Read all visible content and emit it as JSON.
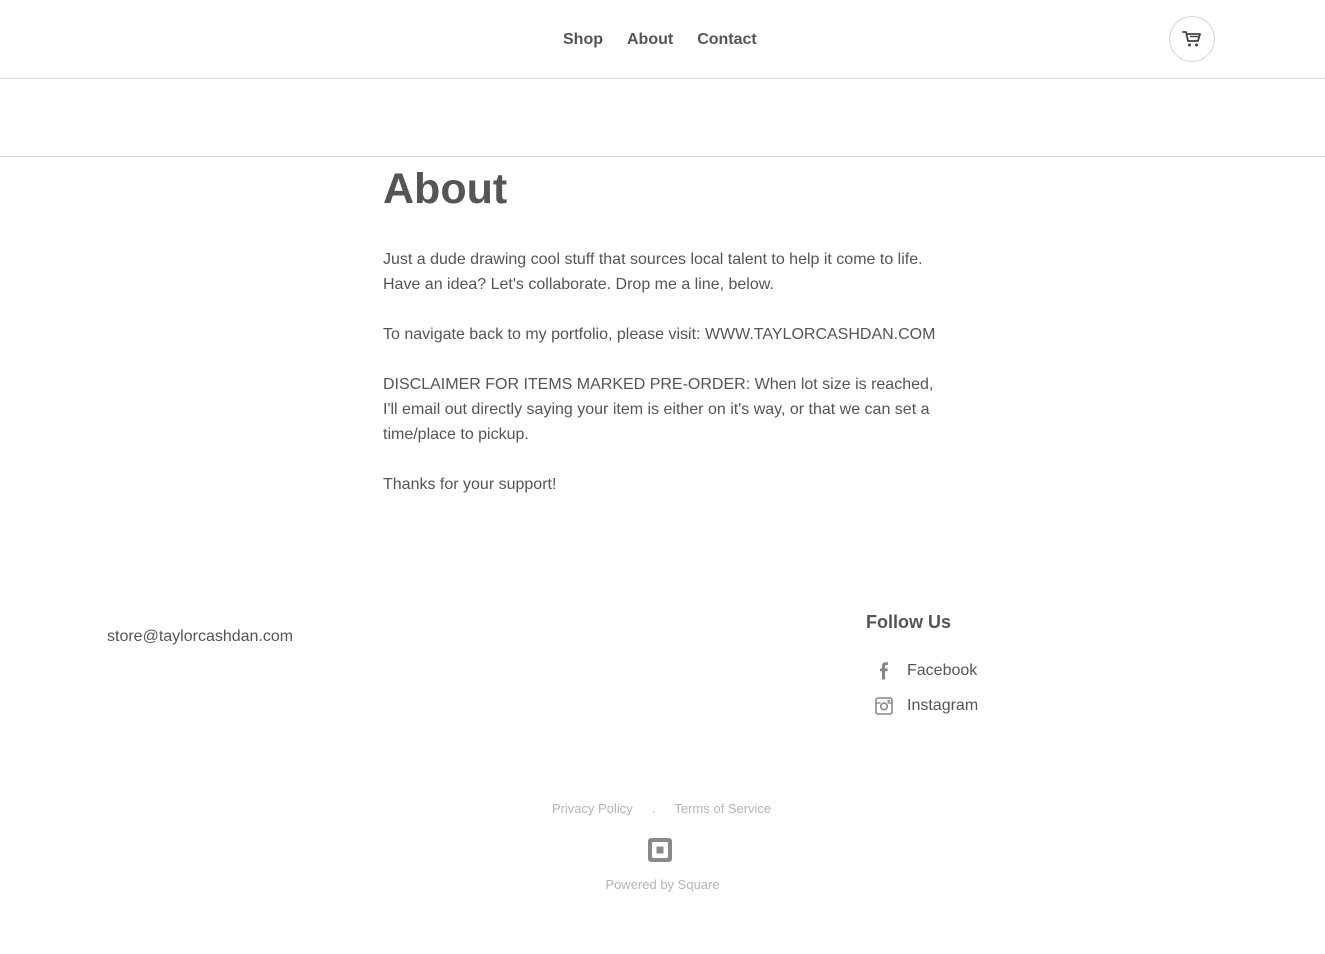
{
  "nav": {
    "items": [
      {
        "label": "Shop"
      },
      {
        "label": "About"
      },
      {
        "label": "Contact"
      }
    ],
    "cart_icon": "cart-icon"
  },
  "page": {
    "title": "About",
    "paragraphs": [
      "Just a dude drawing cool stuff that sources local talent to help it come to life. Have an idea? Let's collaborate. Drop me a line, below.",
      "To navigate back to my portfolio, please visit: WWW.TAYLORCASHDAN.COM",
      "DISCLAIMER FOR ITEMS MARKED PRE-ORDER: When lot size is reached, I'll email out directly saying your item is either on it's way, or that we can set a time/place to pickup.",
      "Thanks for your support!"
    ]
  },
  "footer": {
    "email": "store@taylorcashdan.com",
    "follow_title": "Follow Us",
    "social": [
      {
        "label": "Facebook",
        "icon": "facebook-icon"
      },
      {
        "label": "Instagram",
        "icon": "instagram-icon"
      }
    ],
    "legal": {
      "privacy": "Privacy Policy",
      "separator": ".",
      "terms": "Terms of Service"
    },
    "powered_by": "Powered by Square"
  },
  "colors": {
    "text": "#555555",
    "muted": "#b4b4b4",
    "divider": "#d8d8d8"
  }
}
